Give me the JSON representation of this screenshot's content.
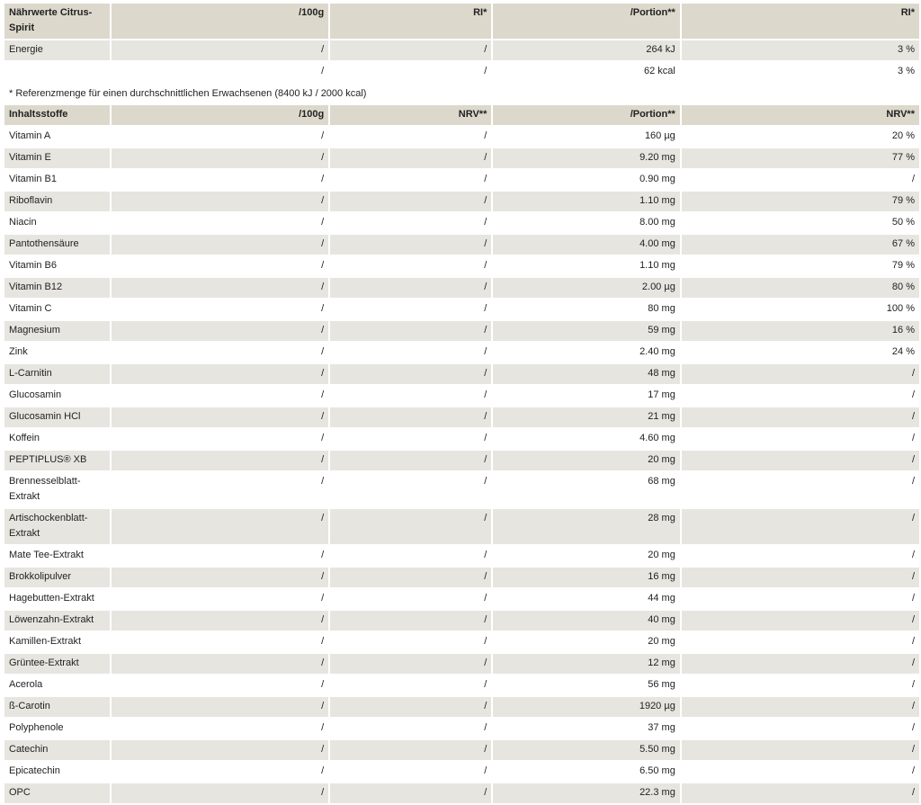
{
  "header1": {
    "col1": "Nährwerte Citrus-Spirit",
    "col2": "/100g",
    "col3": "RI*",
    "col4": "/Portion**",
    "col5": "RI*"
  },
  "energy_rows": [
    [
      "Energie",
      "/",
      "/",
      "264 kJ",
      "3 %"
    ],
    [
      "",
      "/",
      "/",
      "62 kcal",
      "3 %"
    ]
  ],
  "footnote": "* Referenzmenge für einen durchschnittlichen Erwachsenen (8400 kJ / 2000 kcal)",
  "header2": {
    "col1": "Inhaltsstoffe",
    "col2": "/100g",
    "col3": "NRV**",
    "col4": "/Portion**",
    "col5": "NRV**"
  },
  "ingredients": [
    [
      "Vitamin A",
      "/",
      "/",
      "160 µg",
      "20 %"
    ],
    [
      "Vitamin E",
      "/",
      "/",
      "9.20 mg",
      "77 %"
    ],
    [
      "Vitamin B1",
      "/",
      "/",
      "0.90 mg",
      "/"
    ],
    [
      "Riboflavin",
      "/",
      "/",
      "1.10 mg",
      "79 %"
    ],
    [
      "Niacin",
      "/",
      "/",
      "8.00 mg",
      "50 %"
    ],
    [
      "Pantothensäure",
      "/",
      "/",
      "4.00 mg",
      "67 %"
    ],
    [
      "Vitamin B6",
      "/",
      "/",
      "1.10 mg",
      "79 %"
    ],
    [
      "Vitamin B12",
      "/",
      "/",
      "2.00 µg",
      "80 %"
    ],
    [
      "Vitamin C",
      "/",
      "/",
      "80 mg",
      "100 %"
    ],
    [
      "Magnesium",
      "/",
      "/",
      "59 mg",
      "16 %"
    ],
    [
      "Zink",
      "/",
      "/",
      "2.40 mg",
      "24 %"
    ],
    [
      "L-Carnitin",
      "/",
      "/",
      "48 mg",
      "/"
    ],
    [
      "Glucosamin",
      "/",
      "/",
      "17 mg",
      "/"
    ],
    [
      "Glucosamin HCl",
      "/",
      "/",
      "21 mg",
      "/"
    ],
    [
      "Koffein",
      "/",
      "/",
      "4.60 mg",
      "/"
    ],
    [
      "PEPTIPLUS® XB",
      "/",
      "/",
      "20 mg",
      "/"
    ],
    [
      "Brennesselblatt-Extrakt",
      "/",
      "/",
      "68 mg",
      "/"
    ],
    [
      "Artischockenblatt-Extrakt",
      "/",
      "/",
      "28 mg",
      "/"
    ],
    [
      "Mate Tee-Extrakt",
      "/",
      "/",
      "20 mg",
      "/"
    ],
    [
      "Brokkolipulver",
      "/",
      "/",
      "16 mg",
      "/"
    ],
    [
      "Hagebutten-Extrakt",
      "/",
      "/",
      "44 mg",
      "/"
    ],
    [
      "Löwenzahn-Extrakt",
      "/",
      "/",
      "40 mg",
      "/"
    ],
    [
      "Kamillen-Extrakt",
      "/",
      "/",
      "20 mg",
      "/"
    ],
    [
      "Grüntee-Extrakt",
      "/",
      "/",
      "12 mg",
      "/"
    ],
    [
      "Acerola",
      "/",
      "/",
      "56 mg",
      "/"
    ],
    [
      "ß-Carotin",
      "/",
      "/",
      "1920 µg",
      "/"
    ],
    [
      "Polyphenole",
      "/",
      "/",
      "37 mg",
      "/"
    ],
    [
      "Catechin",
      "/",
      "/",
      "5.50 mg",
      "/"
    ],
    [
      "Epicatechin",
      "/",
      "/",
      "6.50 mg",
      "/"
    ],
    [
      "OPC",
      "/",
      "/",
      "22.3 mg",
      "/"
    ]
  ]
}
